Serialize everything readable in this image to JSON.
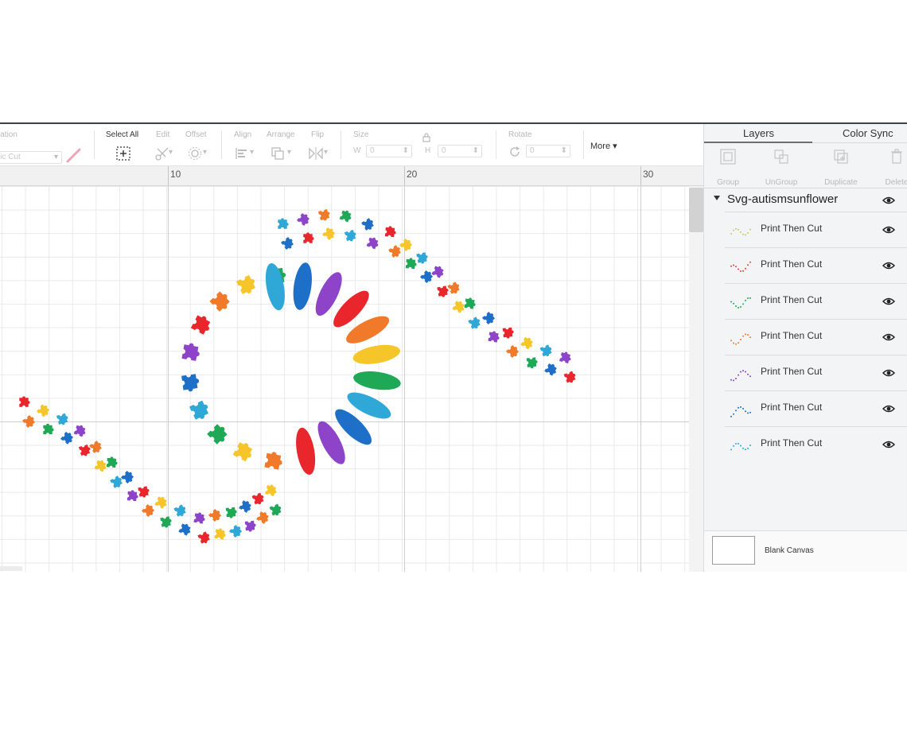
{
  "toolbar": {
    "operation_label": "Operation",
    "operation_value": "Basic Cut",
    "select_all_label": "Select All",
    "edit_label": "Edit",
    "offset_label": "Offset",
    "align_label": "Align",
    "arrange_label": "Arrange",
    "flip_label": "Flip",
    "size_label": "Size",
    "w_label": "W",
    "w_value": "0",
    "h_label": "H",
    "h_value": "0",
    "rotate_label": "Rotate",
    "rotate_value": "0",
    "more_label": "More ▾"
  },
  "ruler": {
    "marks": [
      "10",
      "20",
      "30"
    ]
  },
  "panel": {
    "tabs": [
      "Layers",
      "Color Sync"
    ],
    "actions": [
      "Group",
      "UnGroup",
      "Duplicate",
      "Delete"
    ],
    "group_name": "Svg-autismsunflower",
    "layers": [
      {
        "name": "Print Then Cut",
        "color": "#c9c96a"
      },
      {
        "name": "Print Then Cut",
        "color": "#e0413b"
      },
      {
        "name": "Print Then Cut",
        "color": "#1fa956"
      },
      {
        "name": "Print Then Cut",
        "color": "#f07a2a"
      },
      {
        "name": "Print Then Cut",
        "color": "#8e44c9"
      },
      {
        "name": "Print Then Cut",
        "color": "#1e6fc8"
      },
      {
        "name": "Print Then Cut",
        "color": "#2fa8d8"
      }
    ],
    "canvas_label": "Blank Canvas"
  },
  "palette": [
    "#e8262b",
    "#f07a2a",
    "#f6c52a",
    "#1fa956",
    "#2fa8d8",
    "#1e6fc8",
    "#8e44c9"
  ]
}
